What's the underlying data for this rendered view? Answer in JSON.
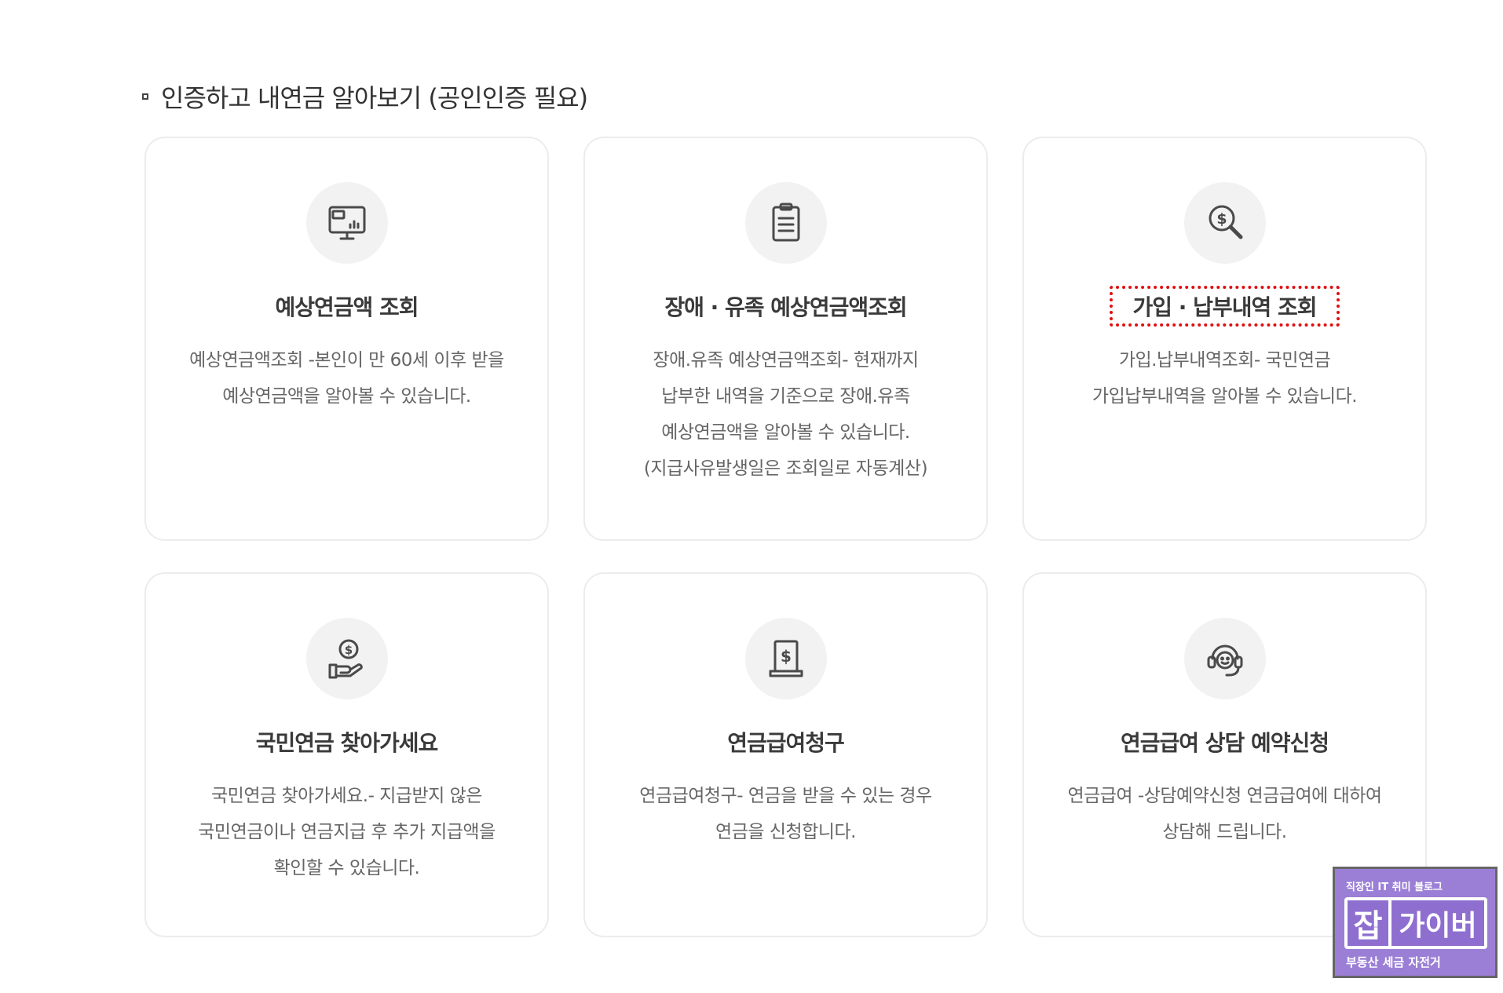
{
  "section": {
    "title": "인증하고 내연금 알아보기 (공인인증 필요)"
  },
  "cards": [
    {
      "icon": "monitor-chart-icon",
      "title": "예상연금액 조회",
      "desc": [
        "예상연금액조회 -본인이 만 60세 이후 받을",
        "예상연금액을 알아볼 수 있습니다."
      ]
    },
    {
      "icon": "clipboard-document-icon",
      "title": "장애 · 유족 예상연금액조회",
      "desc": [
        "장애.유족 예상연금액조회- 현재까지",
        "납부한 내역을 기준으로 장애.유족",
        "예상연금액을 알아볼 수 있습니다.",
        "(지급사유발생일은 조회일로 자동계산)"
      ]
    },
    {
      "icon": "dollar-search-icon",
      "title": "가입 · 납부내역 조회",
      "desc": [
        "가입.납부내역조회- 국민연금",
        "가입납부내역을 알아볼 수 있습니다."
      ]
    },
    {
      "icon": "hand-dollar-icon",
      "title": "국민연금 찾아가세요",
      "desc": [
        "국민연금 찾아가세요.- 지급받지 않은",
        "국민연금이나 연금지급 후 추가 지급액을",
        "확인할 수 있습니다."
      ]
    },
    {
      "icon": "dollar-document-icon",
      "title": "연금급여청구",
      "desc": [
        "연금급여청구- 연금을 받을 수 있는 경우",
        "연금을 신청합니다."
      ]
    },
    {
      "icon": "headset-consult-icon",
      "title": "연금급여 상담 예약신청",
      "desc": [
        "연금급여 -상담예약신청 연금급여에 대하여",
        "상담해 드립니다."
      ]
    }
  ],
  "badge": {
    "top": "직장인 IT 취미 블로그",
    "char": "잡",
    "name": "가이버",
    "bottom": "부동산 세금 자전거"
  },
  "colors": {
    "highlight_border": "#e01010",
    "badge_bg": "#9b7fd6",
    "icon_bg": "#f2f2f2"
  }
}
